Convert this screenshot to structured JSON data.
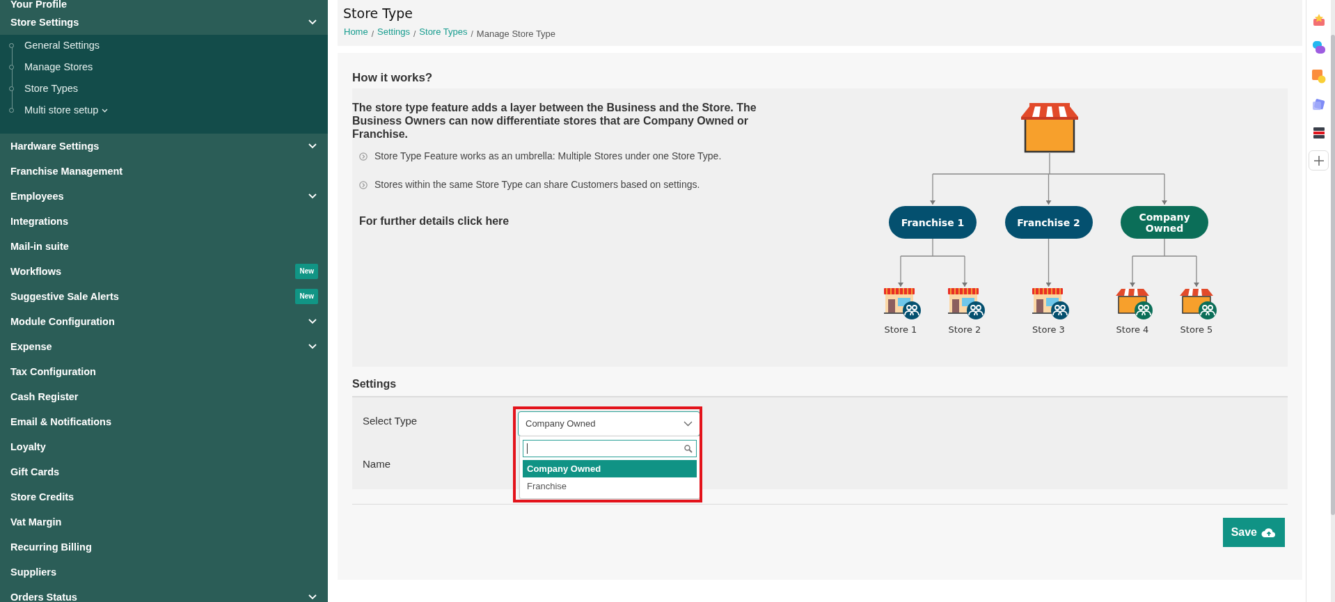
{
  "sidebar": {
    "items": [
      {
        "label": "Your Profile"
      },
      {
        "label": "Store Settings",
        "submenu": true,
        "children": [
          {
            "label": "General Settings"
          },
          {
            "label": "Manage Stores"
          },
          {
            "label": "Store Types"
          },
          {
            "label": "Multi store setup",
            "submenu": true
          }
        ]
      },
      {
        "label": "Hardware Settings",
        "submenu": true
      },
      {
        "label": "Franchise Management"
      },
      {
        "label": "Employees",
        "submenu": true
      },
      {
        "label": "Integrations"
      },
      {
        "label": "Mail-in suite"
      },
      {
        "label": "Workflows",
        "badge": "New"
      },
      {
        "label": "Suggestive Sale Alerts",
        "badge": "New"
      },
      {
        "label": "Module Configuration",
        "submenu": true
      },
      {
        "label": "Expense",
        "submenu": true
      },
      {
        "label": "Tax Configuration"
      },
      {
        "label": "Cash Register"
      },
      {
        "label": "Email & Notifications"
      },
      {
        "label": "Loyalty"
      },
      {
        "label": "Gift Cards"
      },
      {
        "label": "Store Credits"
      },
      {
        "label": "Vat Margin"
      },
      {
        "label": "Recurring Billing"
      },
      {
        "label": "Suppliers"
      },
      {
        "label": "Orders Status",
        "submenu": true
      }
    ]
  },
  "header": {
    "title": "Store Type",
    "separator": "/",
    "breadcrumb": [
      {
        "label": "Home",
        "current": false
      },
      {
        "label": "Settings",
        "current": false
      },
      {
        "label": "Store Types",
        "current": false
      },
      {
        "label": "Manage Store Type",
        "current": true
      }
    ]
  },
  "how_it_works": {
    "title": "How it works?",
    "intro": "The store type feature adds a layer between the Business and the Store. The Business Owners can now differentiate stores that are Company Owned or Franchise.",
    "bullets": [
      "Store Type Feature works as an umbrella: Multiple Stores under one Store Type.",
      "Stores within the same Store Type can share Customers based on settings."
    ],
    "link": "For further details click here",
    "diagram": {
      "groups": [
        {
          "label": "Franchise 1",
          "color": "#04506f",
          "stores": [
            {
              "label": "Store 1",
              "kind": "kiosk",
              "color": "#04506f"
            },
            {
              "label": "Store 2",
              "kind": "kiosk",
              "color": "#04506f"
            }
          ]
        },
        {
          "label": "Franchise 2",
          "color": "#04506f",
          "stores": [
            {
              "label": "Store 3",
              "kind": "kiosk",
              "color": "#04506f"
            }
          ]
        },
        {
          "label": "Company Owned",
          "color": "#0b6e58",
          "stores": [
            {
              "label": "Store 4",
              "kind": "shop",
              "color": "#0b6e58"
            },
            {
              "label": "Store 5",
              "kind": "shop",
              "color": "#0b6e58"
            }
          ]
        }
      ]
    }
  },
  "settings": {
    "title": "Settings",
    "select": {
      "label": "Select Type",
      "value": "Company Owned",
      "open": true,
      "highlighted": true,
      "options": [
        {
          "label": "Company Owned",
          "selected": true
        },
        {
          "label": "Franchise",
          "selected": false
        }
      ]
    },
    "name_field": {
      "label": "Name"
    }
  },
  "save_button": "Save"
}
